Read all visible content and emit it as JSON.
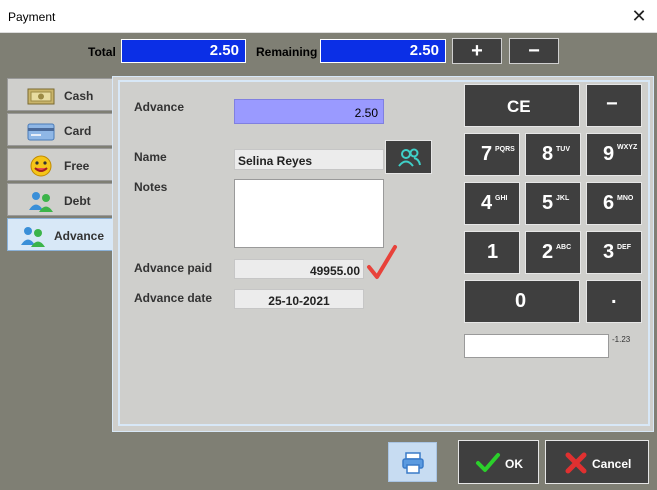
{
  "window": {
    "title": "Payment",
    "close_glyph": "✕"
  },
  "summary": {
    "total_label": "Total",
    "total_value": "2.50",
    "remaining_label": "Remaining",
    "remaining_value": "2.50",
    "plus_glyph": "+",
    "minus_glyph": "−"
  },
  "tabs": [
    {
      "label": "Cash",
      "icon": "cash-icon"
    },
    {
      "label": "Card",
      "icon": "card-icon"
    },
    {
      "label": "Free",
      "icon": "free-icon"
    },
    {
      "label": "Debt",
      "icon": "debt-icon"
    },
    {
      "label": "Advance",
      "icon": "advance-icon",
      "active": true
    }
  ],
  "form": {
    "advance_label": "Advance",
    "advance_value": "2.50",
    "name_label": "Name",
    "name_value": "Selina Reyes",
    "notes_label": "Notes",
    "notes_value": "",
    "advance_paid_label": "Advance paid",
    "advance_paid_value": "49955.00",
    "advance_date_label": "Advance date",
    "advance_date_value": "25-10-2021"
  },
  "keypad": {
    "ce": "CE",
    "minus": "−",
    "keys": [
      {
        "digit": "7",
        "letters": "PQRS"
      },
      {
        "digit": "8",
        "letters": "TUV"
      },
      {
        "digit": "9",
        "letters": "WXYZ"
      },
      {
        "digit": "4",
        "letters": "GHI"
      },
      {
        "digit": "5",
        "letters": "JKL"
      },
      {
        "digit": "6",
        "letters": "MNO"
      },
      {
        "digit": "1",
        "letters": ""
      },
      {
        "digit": "2",
        "letters": "ABC"
      },
      {
        "digit": "3",
        "letters": "DEF"
      }
    ],
    "zero": "0",
    "dot": ".",
    "display_value": "",
    "display_hint": "-1.23"
  },
  "buttons": {
    "ok": "OK",
    "cancel": "Cancel"
  },
  "colors": {
    "accent_blue": "#0b2fe6",
    "advance_field": "#9a9aff",
    "check_red": "#e8423a",
    "ok_green": "#2bd02b",
    "cancel_red": "#e03030"
  }
}
